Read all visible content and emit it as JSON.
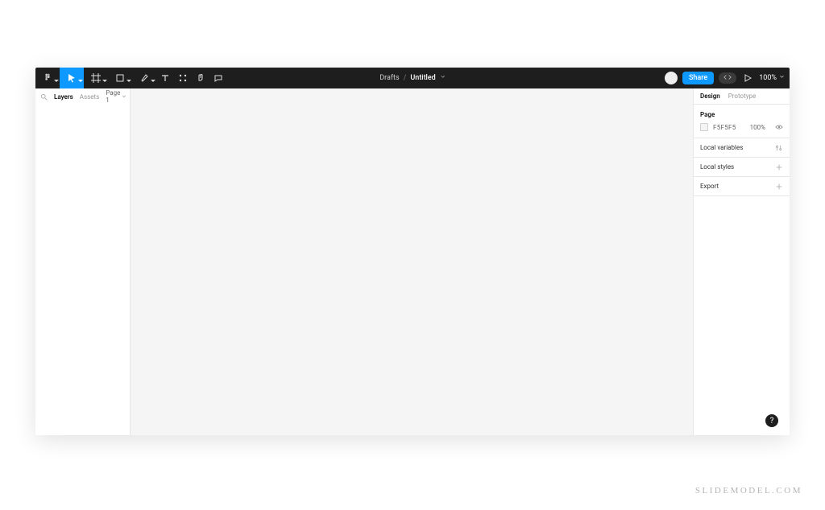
{
  "toolbar": {
    "breadcrumb": {
      "parent": "Drafts",
      "sep": "/",
      "title": "Untitled"
    },
    "share_label": "Share",
    "zoom_label": "100%"
  },
  "left_panel": {
    "tabs": {
      "layers": "Layers",
      "assets": "Assets"
    },
    "page_label": "Page 1"
  },
  "right_panel": {
    "tabs": {
      "design": "Design",
      "prototype": "Prototype"
    },
    "page_section": {
      "title": "Page",
      "color_hex": "F5F5F5",
      "opacity": "100%"
    },
    "rows": {
      "local_variables": "Local variables",
      "local_styles": "Local styles",
      "export": "Export"
    }
  },
  "help": {
    "text": "?"
  },
  "watermark": "SLIDEMODEL.COM"
}
